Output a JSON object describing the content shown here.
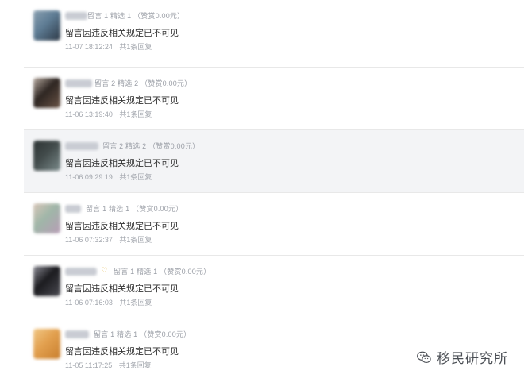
{
  "comments": [
    {
      "name_hidden": true,
      "stats": "留言 1 精选 1 （赞赏0.00元）",
      "message": "留言因违反相关规定已不可见",
      "time": "11-07 18:12:24",
      "replies": "共1条回复",
      "highlight": false,
      "avatar_colors": [
        "#5e7c94",
        "#2d3947",
        "#8aa0b1"
      ]
    },
    {
      "name_hidden": true,
      "stats": "留言 2 精选 2 （赞赏0.00元）",
      "message": "留言因违反相关规定已不可见",
      "time": "11-06 13:19:40",
      "replies": "共1条回复",
      "highlight": false,
      "avatar_colors": [
        "#2e2622",
        "#6a5446",
        "#b7aaa0"
      ]
    },
    {
      "name_hidden": true,
      "stats": "留言 2 精选 2 （赞赏0.00元）",
      "message": "留言因违反相关规定已不可见",
      "time": "11-06 09:29:19",
      "replies": "共1条回复",
      "highlight": true,
      "avatar_colors": [
        "#424b4b",
        "#7a8a8a",
        "#2c3333"
      ]
    },
    {
      "name_hidden": true,
      "stats": "留言 1 精选 1 （赞赏0.00元）",
      "message": "留言因违反相关规定已不可见",
      "time": "11-06 07:32:37",
      "replies": "共1条回复",
      "highlight": false,
      "avatar_colors": [
        "#9fb6a8",
        "#b89db6",
        "#d9c6b8"
      ]
    },
    {
      "name_hidden": true,
      "stats": "留言 1 精选 1 （赞赏0.00元）",
      "message": "留言因违反相关规定已不可见",
      "time": "11-06 07:16:03",
      "replies": "共1条回复",
      "highlight": false,
      "vip_badge": true,
      "avatar_colors": [
        "#1b1b1f",
        "#4b4b52",
        "#8d8d96"
      ]
    },
    {
      "name_hidden": true,
      "stats": "留言 1 精选 1 （赞赏0.00元）",
      "message": "留言因违反相关规定已不可见",
      "time": "11-05 11:17:25",
      "replies": "共1条回复",
      "highlight": false,
      "avatar_colors": [
        "#e2a04f",
        "#c97f2e",
        "#f1c784"
      ]
    }
  ],
  "watermark": {
    "text": "移民研究所",
    "icon": "wechat-icon"
  },
  "colors": {
    "divider": "#e8e8e8",
    "highlight_bg": "#f3f4f6",
    "vip_badge": "#e0b341"
  }
}
